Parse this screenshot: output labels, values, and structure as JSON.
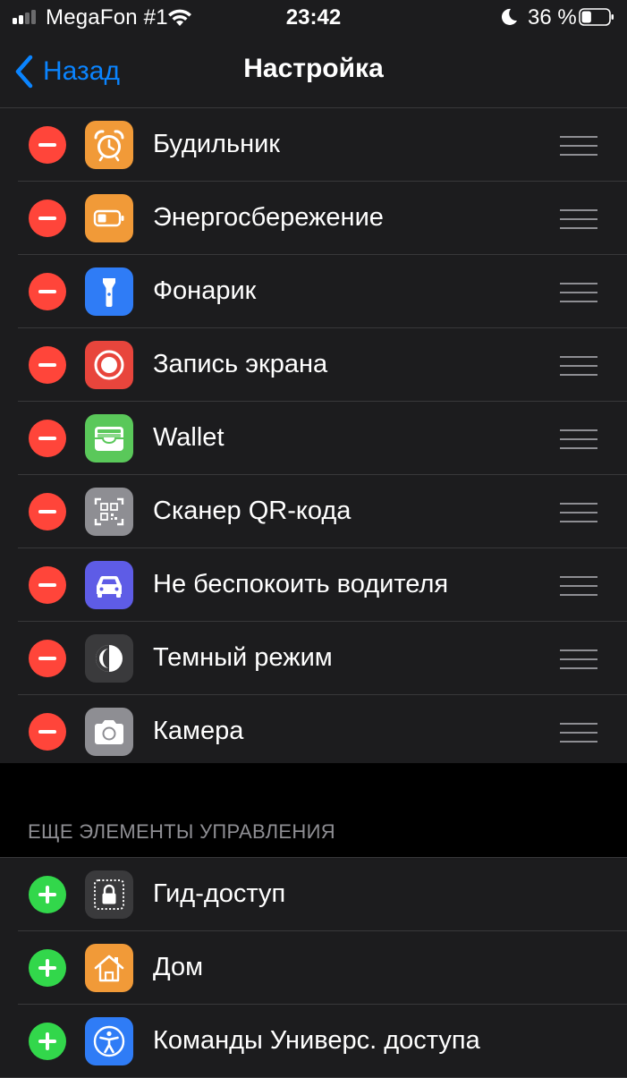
{
  "status_bar": {
    "carrier": "MegaFon #1",
    "time": "23:42",
    "battery_percent": "36 %",
    "battery_level": 0.36,
    "signal_bars_active": 2,
    "signal_bars_total": 4,
    "icons": [
      "signal-icon",
      "wifi-icon",
      "moon-icon",
      "battery-icon"
    ]
  },
  "nav": {
    "back_label": "Назад",
    "title": "Настройка"
  },
  "included": {
    "items": [
      {
        "label": "Будильник",
        "icon": "alarm-clock-icon",
        "color": "#f19a38"
      },
      {
        "label": "Энергосбережение",
        "icon": "battery-saver-icon",
        "color": "#f19a38"
      },
      {
        "label": "Фонарик",
        "icon": "flashlight-icon",
        "color": "#2f7cf6"
      },
      {
        "label": "Запись экрана",
        "icon": "screen-record-icon",
        "color": "#e8453c"
      },
      {
        "label": "Wallet",
        "icon": "wallet-icon",
        "color": "#5ac85a"
      },
      {
        "label": "Сканер QR-кода",
        "icon": "qr-scanner-icon",
        "color": "#8e8e93"
      },
      {
        "label": "Не беспокоить водителя",
        "icon": "car-icon",
        "color": "#5e5ce6"
      },
      {
        "label": "Темный режим",
        "icon": "dark-mode-icon",
        "color": "#3a3a3c"
      },
      {
        "label": "Камера",
        "icon": "camera-icon",
        "color": "#8e8e93"
      }
    ]
  },
  "more": {
    "header": "ЕЩЕ ЭЛЕМЕНТЫ УПРАВЛЕНИЯ",
    "items": [
      {
        "label": "Гид-доступ",
        "icon": "guided-access-icon",
        "color": "#3a3a3c"
      },
      {
        "label": "Дом",
        "icon": "home-icon",
        "color": "#f19a38"
      },
      {
        "label": "Команды Универс. доступа",
        "icon": "accessibility-icon",
        "color": "#2f7cf6"
      }
    ]
  },
  "colors": {
    "accent": "#0a84ff",
    "remove": "#ff453a",
    "add": "#32d74b",
    "row_background": "#1c1c1e",
    "background": "#000000"
  }
}
